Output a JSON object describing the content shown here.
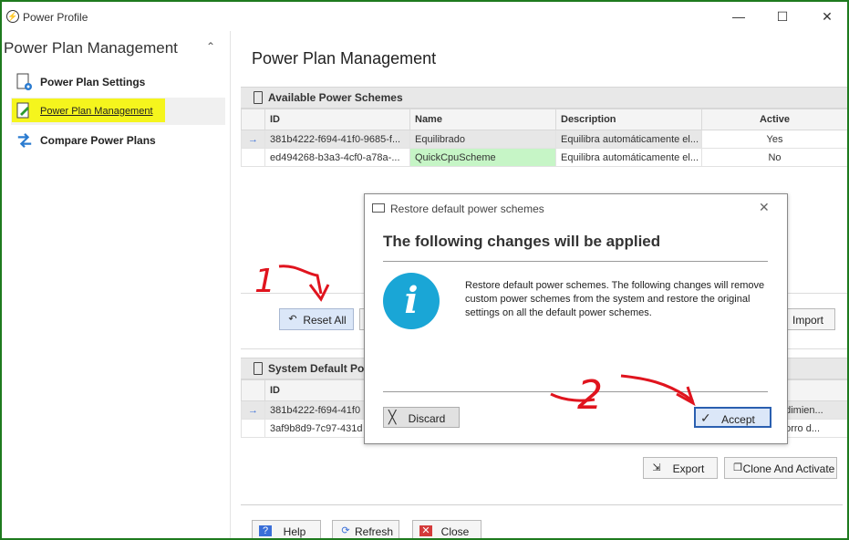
{
  "window": {
    "title": "Power Profile",
    "minimize": "—",
    "maximize": "☐",
    "close": "✕"
  },
  "sidebar": {
    "title": "Power Plan Management",
    "collapse": "^",
    "items": [
      {
        "label": "Power Plan Settings",
        "icon": "settings-page-icon"
      },
      {
        "label": "Power Plan Management",
        "icon": "edit-page-icon"
      },
      {
        "label": "Compare Power Plans",
        "icon": "compare-arrows-icon"
      }
    ]
  },
  "main": {
    "title": "Power Plan Management",
    "available": {
      "header": "Available Power Schemes",
      "columns": [
        "ID",
        "Name",
        "Description",
        "Active"
      ],
      "rows": [
        {
          "indicator": "→",
          "id": "381b4222-f694-41f0-9685-f...",
          "name": "Equilibrado",
          "description": "Equilibra automáticamente el...",
          "active": "Yes"
        },
        {
          "indicator": "",
          "id": "ed494268-b3a3-4cf0-a78a-...",
          "name": "QuickCpuScheme",
          "description": "Equilibra automáticamente el...",
          "active": "No"
        }
      ],
      "buttons": {
        "reset_all": "Reset All",
        "import": "Import"
      }
    },
    "system_default": {
      "header": "System Default Po",
      "columns": [
        "ID"
      ],
      "rows": [
        {
          "indicator": "→",
          "id": "381b4222-f694-41f0",
          "tail": "ndimien..."
        },
        {
          "indicator": "",
          "id": "3af9b8d9-7c97-431d",
          "tail": "horro d..."
        }
      ],
      "buttons": {
        "export": "Export",
        "clone_activate": "Clone And Activate"
      }
    },
    "footer": {
      "help": "Help",
      "refresh": "Refresh",
      "close": "Close"
    }
  },
  "dialog": {
    "title": "Restore default power schemes",
    "close": "✕",
    "heading": "The following changes will be applied",
    "info_glyph": "i",
    "message": "Restore default power schemes. The following changes will remove custom power schemes from the system and restore the original settings on all the default power schemes.",
    "discard": "Discard",
    "accept": "Accept"
  },
  "annotations": {
    "step1": "1",
    "step2": "2",
    "color": "#e0141e"
  }
}
